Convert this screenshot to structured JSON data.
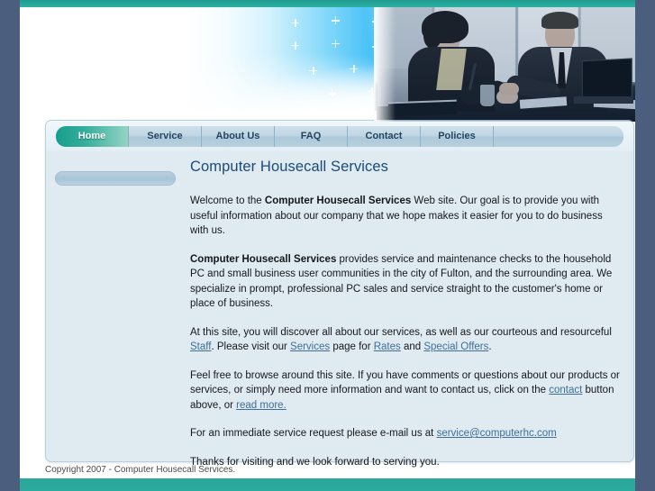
{
  "site": {
    "title": "Computer Housecall Services"
  },
  "nav": {
    "items": [
      {
        "label": "Home",
        "active": true
      },
      {
        "label": "Service",
        "active": false
      },
      {
        "label": "About Us",
        "active": false
      },
      {
        "label": "FAQ",
        "active": false
      },
      {
        "label": "Contact",
        "active": false
      },
      {
        "label": "Policies",
        "active": false
      }
    ]
  },
  "sidebar": {
    "items": [
      {
        "label": ""
      }
    ]
  },
  "content": {
    "heading": "Computer Housecall Services",
    "p1_a": "Welcome to the ",
    "p1_b": "Computer Housecall Services",
    "p1_c": " Web site. Our goal is to provide you with useful information about our company that we hope makes it easier for you to do business with us.",
    "p2_a": "Computer Housecall Services",
    "p2_b": " provides service and maintenance checks to the household PC and small business user communities in the city of Fulton, and the surrounding area. We specialize in prompt, professional PC sales and service straight to the customer's home or place of business.",
    "p3_a": "At this site, you will discover all about our services, as well as our courteous and resourceful ",
    "p3_link_staff": "Staff",
    "p3_b": ". Please visit our ",
    "p3_link_services": "Services",
    "p3_c": " page for ",
    "p3_link_rates": "Rates",
    "p3_d": " and ",
    "p3_link_offers": "Special Offers",
    "p3_e": ".",
    "p4_a": "Feel free to browse around this site. If you have comments or questions about our products or services, or simply need more information and want to contact us, click on the ",
    "p4_link_contact": "contact",
    "p4_b": " button above, or ",
    "p4_link_readmore": "read more.",
    "p5_a": "For an immediate service request please e-mail us at ",
    "p5_link_email": "service@computerhc.com",
    "p6": "Thanks for visiting and we look forward to serving you."
  },
  "footer": {
    "copyright": "Copyright 2007 - Computer Housecall Services."
  },
  "colors": {
    "page_background": "#4c5e7d",
    "accent_teal": "#21a093",
    "panel_background": "#dfeaf1",
    "heading_blue": "#1b4b78",
    "link_blue": "#3f6f96"
  }
}
